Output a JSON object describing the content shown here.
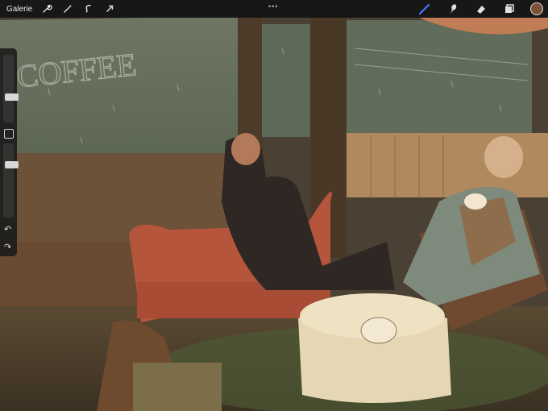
{
  "app": {
    "gallery_label": "Galerie",
    "more_dots": "•••"
  },
  "toolbar": {
    "left_tools": [
      {
        "name": "wrench-icon"
      },
      {
        "name": "magic-wand-icon"
      },
      {
        "name": "selection-icon"
      },
      {
        "name": "transform-arrow-icon"
      }
    ],
    "right_tools": [
      {
        "name": "brush-icon",
        "active": true
      },
      {
        "name": "smudge-icon"
      },
      {
        "name": "eraser-icon"
      },
      {
        "name": "layers-icon"
      }
    ],
    "current_color": "#7a5236",
    "active_color": "#3b7bff"
  },
  "sidebar": {
    "brush_size_level": 0.36,
    "opacity_level": 0.74,
    "undo_symbol": "↶",
    "redo_symbol": "↷"
  },
  "canvas": {
    "window_sign_text": "COFFEE"
  }
}
